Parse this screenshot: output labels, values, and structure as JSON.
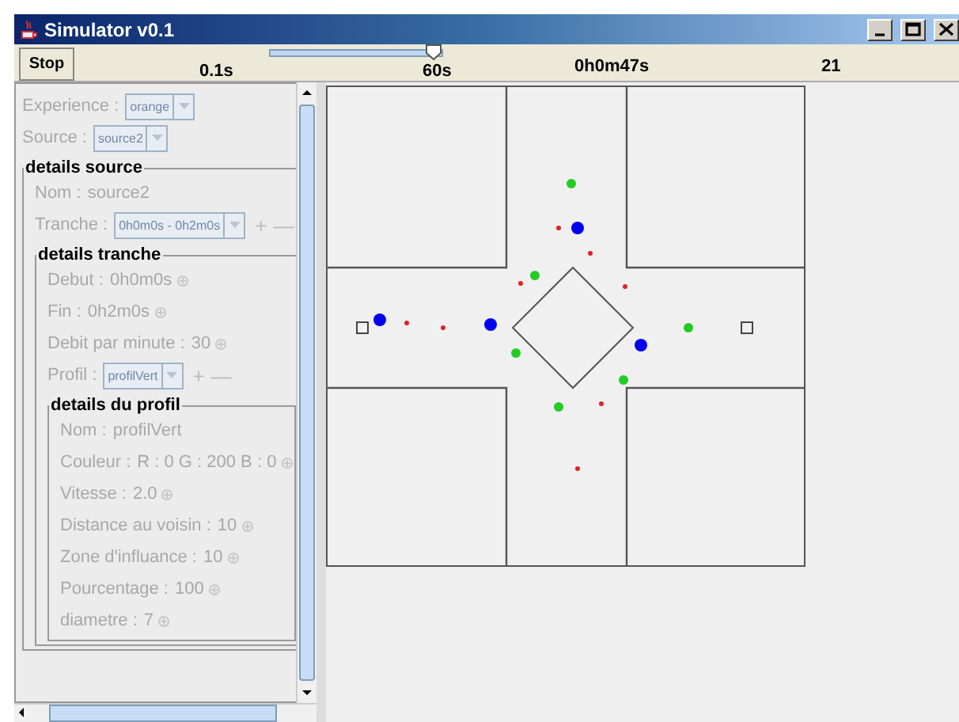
{
  "window": {
    "title": "Simulator v0.1"
  },
  "toolbar": {
    "stop_label": "Stop",
    "slider": {
      "level": 0.95,
      "min_label": "0.1s",
      "max_label": "60s"
    },
    "time": "0h0m47s",
    "count": "21"
  },
  "panel": {
    "disabled": true,
    "fields": [
      {
        "kind": "combo",
        "label": "Experience :",
        "value": "orange"
      },
      {
        "kind": "combo",
        "label": "Source :",
        "value": "source2"
      }
    ],
    "group": {
      "title": "details source",
      "fields": [
        {
          "kind": "text",
          "label": "Nom :",
          "value": "source2"
        },
        {
          "kind": "combo",
          "label": "Tranche :",
          "value": "0h0m0s - 0h2m0s",
          "add": "+",
          "remove": "—"
        }
      ],
      "group": {
        "title": "details tranche",
        "fields": [
          {
            "kind": "spin",
            "label": "Debut :",
            "value": "0h0m0s"
          },
          {
            "kind": "spin",
            "label": "Fin :",
            "value": "0h2m0s"
          },
          {
            "kind": "spin",
            "label": "Debit par minute :",
            "value": "30"
          },
          {
            "kind": "combo",
            "label": "Profil :",
            "value": "profilVert",
            "add": "+",
            "remove": "—"
          }
        ],
        "group": {
          "title": "details du profil",
          "fields": [
            {
              "kind": "text",
              "label": "Nom :",
              "value": "profilVert"
            },
            {
              "kind": "spin",
              "label": "Couleur :",
              "value": "R : 0 G : 200 B : 0"
            },
            {
              "kind": "spin",
              "label": "Vitesse :",
              "value": "2.0"
            },
            {
              "kind": "spin",
              "label": "Distance au voisin :",
              "value": "10"
            },
            {
              "kind": "spin",
              "label": "Zone d'influance :",
              "value": "10"
            },
            {
              "kind": "spin",
              "label": "Pourcentage :",
              "value": "100"
            },
            {
              "kind": "spin",
              "label": "diametre :",
              "value": "7"
            }
          ]
        }
      }
    }
  }
}
